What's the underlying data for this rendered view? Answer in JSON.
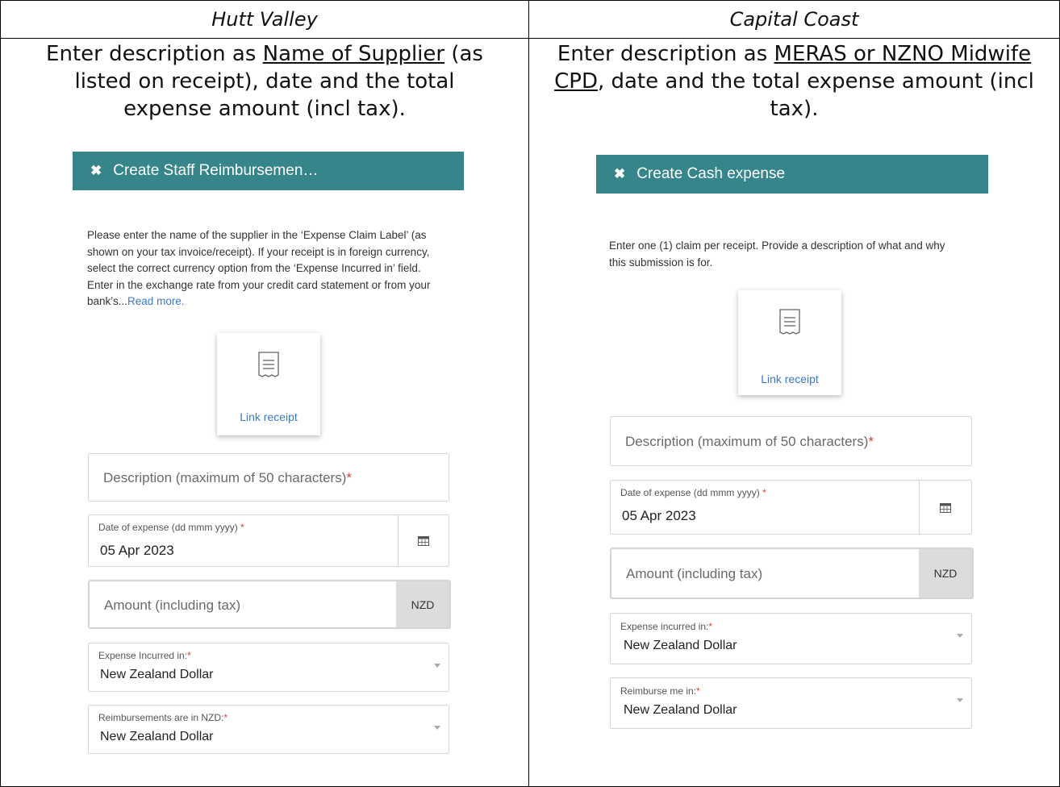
{
  "left": {
    "header": "Hutt Valley",
    "instruction": {
      "pre": "Enter description as ",
      "emph": "Name of Supplier",
      "post": " (as listed on receipt), date and the total expense amount (incl tax)."
    },
    "panel_title": "Create Staff Reimbursemen…",
    "help_text": "Please enter the name of the supplier in the ‘Expense Claim Label’ (as shown on your tax invoice/receipt). If your receipt is in foreign currency, select the correct currency option from the ‘Expense Incurred in’ field. Enter in the exchange rate from your credit card statement or from your bank’s...",
    "help_link": "Read more.",
    "receipt_label": "Link receipt",
    "description_placeholder": "Description (maximum of 50 characters)",
    "date_label": "Date of expense (dd mmm yyyy)",
    "date_value": "05 Apr 2023",
    "amount_placeholder": "Amount (including tax)",
    "currency_code": "NZD",
    "incurred_label": "Expense Incurred in:",
    "incurred_value": "New Zealand Dollar",
    "reimburse_label": "Reimbursements are in NZD:",
    "reimburse_value": "New Zealand Dollar"
  },
  "right": {
    "header": "Capital Coast",
    "instruction": {
      "pre": "Enter description as ",
      "emph": "MERAS or NZNO Midwife CPD",
      "post": ", date and the total expense amount (incl tax)."
    },
    "panel_title": "Create Cash expense",
    "help_text": "Enter one (1) claim per receipt. Provide a description of what and why this submission is for.",
    "receipt_label": "Link receipt",
    "description_placeholder": "Description (maximum of 50 characters)",
    "date_label": "Date of expense (dd mmm yyyy)",
    "date_value": "05 Apr 2023",
    "amount_placeholder": "Amount (including tax)",
    "currency_code": "NZD",
    "incurred_label": "Expense incurred in:",
    "incurred_value": "New Zealand Dollar",
    "reimburse_label": "Reimburse me in:",
    "reimburse_value": "New Zealand Dollar"
  },
  "required_mark": "*",
  "icons": {
    "close": "close-icon",
    "receipt": "receipt-icon",
    "calendar": "calendar-icon",
    "dropdown": "chevron-down-icon"
  },
  "colors": {
    "panel_header": "#35858a",
    "link": "#3a78c4",
    "required": "#d0453f"
  }
}
